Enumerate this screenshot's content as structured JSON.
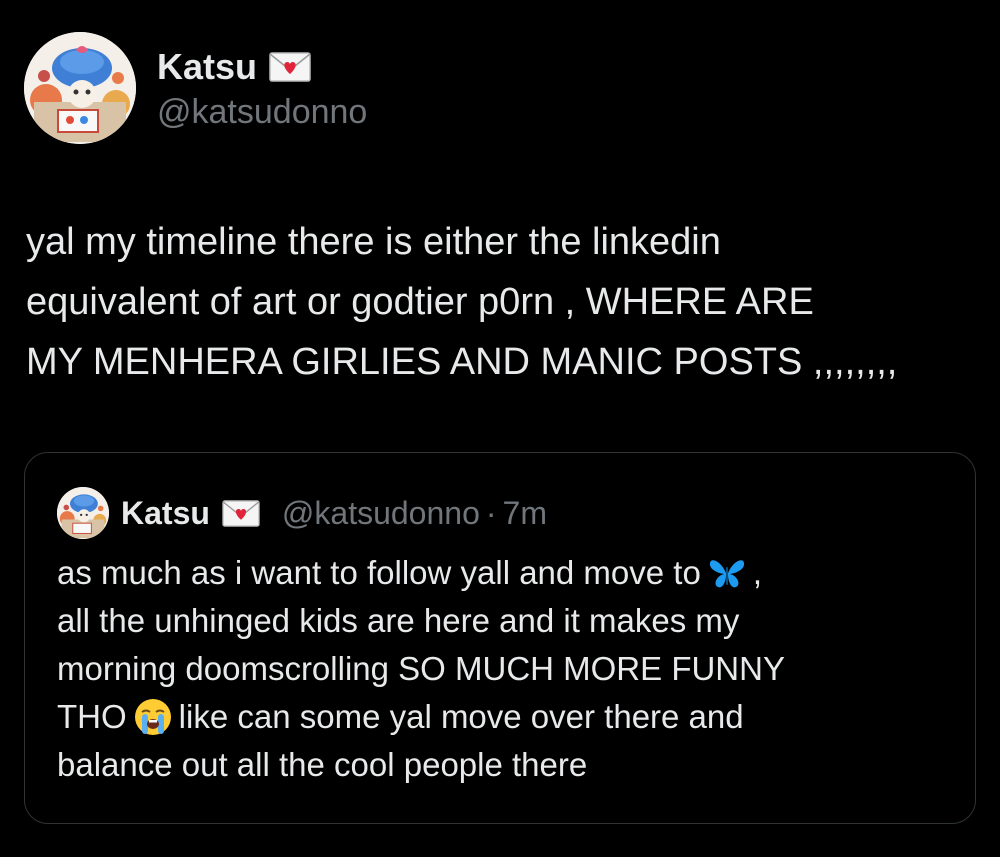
{
  "author": {
    "display_name": "Katsu",
    "handle": "@katsudonno",
    "name_badge_icon": "love-letter-icon"
  },
  "tweet": {
    "lines": [
      "yal my timeline there is either the linkedin",
      "equivalent of art or godtier p0rn , WHERE ARE",
      "MY MENHERA GIRLIES AND MANIC POSTS ,,,,,,,,"
    ]
  },
  "quoted_tweet": {
    "display_name": "Katsu",
    "handle": "@katsudonno",
    "separator": "·",
    "time": "7m",
    "line1_before_emoji": "as much as i want to follow yall and move to",
    "line1_emoji": "butterfly-icon",
    "line1_after_emoji": ",",
    "line2": "all the unhinged kids are here and it makes my",
    "line3": "morning doomscrolling SO MUCH MORE FUNNY",
    "line4_before_emoji": "THO",
    "line4_emoji": "loudly-crying-face-icon",
    "line4_after_emoji": "like can some yal move over there and",
    "line5": "balance out all the cool people there"
  },
  "colors": {
    "background": "#000000",
    "primary_text": "#e7e9ea",
    "secondary_text": "#71767b",
    "border": "#2f3336",
    "butterfly": "#1d9bf0"
  }
}
